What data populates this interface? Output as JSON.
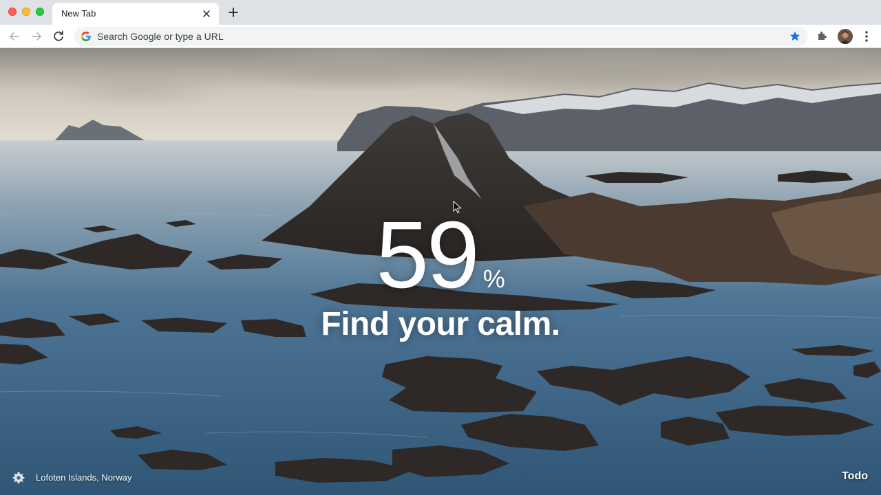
{
  "window": {
    "controls": [
      "close",
      "minimize",
      "zoom"
    ]
  },
  "tabs": [
    {
      "title": "New Tab",
      "active": true
    }
  ],
  "toolbar": {
    "omnibox_placeholder": "Search Google or type a URL",
    "bookmark_icon": "star-icon",
    "extensions_icon": "puzzle-icon",
    "menu_icon": "kebab-menu-icon",
    "accent_color": "#1a73e8"
  },
  "newtab": {
    "count": "59",
    "unit": "%",
    "tagline": "Find your calm.",
    "location": "Lofoten Islands, Norway",
    "todo_label": "Todo",
    "settings_icon": "gear-icon"
  }
}
